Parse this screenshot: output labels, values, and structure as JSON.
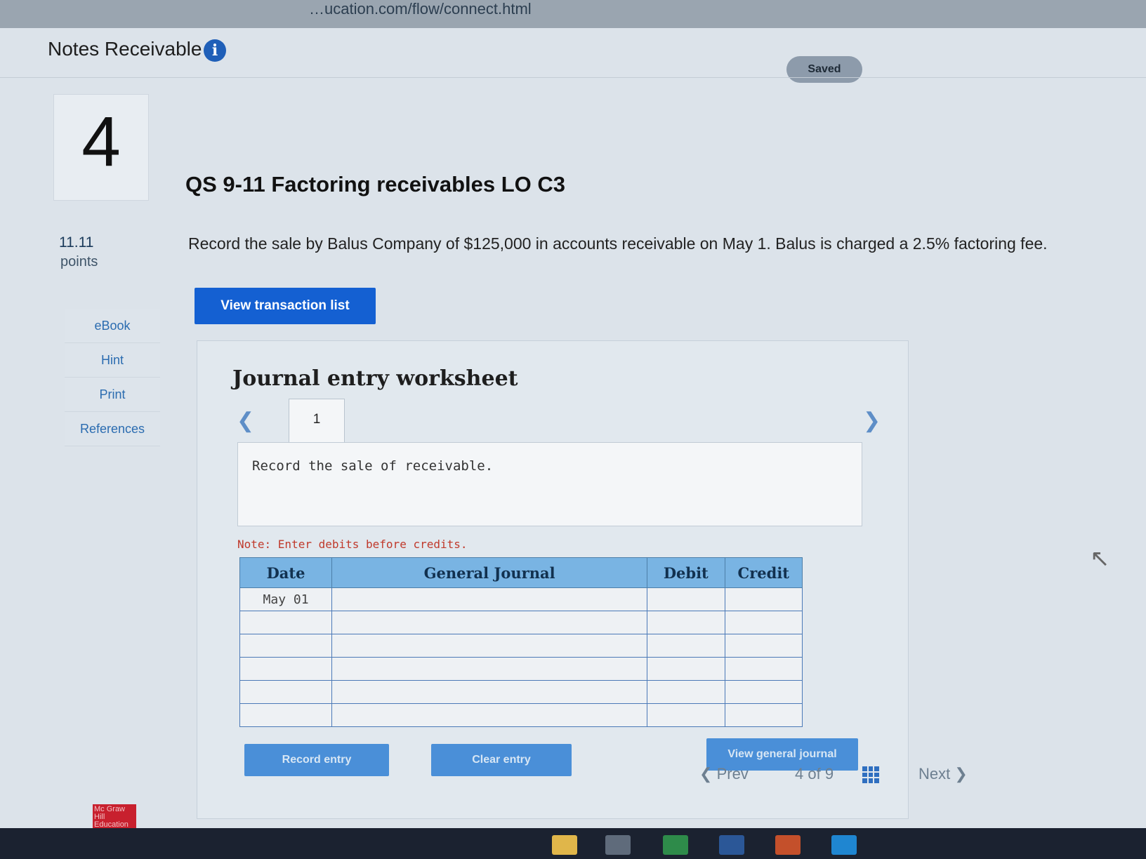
{
  "browser": {
    "url": "…ucation.com/flow/connect.html"
  },
  "header": {
    "title": "Notes Receivable",
    "saved_label": "Saved"
  },
  "question": {
    "number": "4",
    "title": "QS 9-11 Factoring receivables LO C3",
    "points_value": "11.11",
    "points_label": "points",
    "text": "Record the sale by Balus Company of $125,000 in accounts receivable on May 1. Balus is charged a 2.5% factoring fee."
  },
  "sidebar": {
    "items": [
      {
        "label": "eBook"
      },
      {
        "label": "Hint"
      },
      {
        "label": "Print"
      },
      {
        "label": "References"
      }
    ]
  },
  "buttons": {
    "view_transaction": "View transaction list",
    "record_entry": "Record entry",
    "clear_entry": "Clear entry",
    "view_general_journal": "View general journal"
  },
  "worksheet": {
    "title": "Journal entry worksheet",
    "tab_label": "1",
    "description": "Record the sale of receivable.",
    "note": "Note: Enter debits before credits.",
    "columns": {
      "date": "Date",
      "journal": "General Journal",
      "debit": "Debit",
      "credit": "Credit"
    },
    "rows": [
      {
        "date": "May 01",
        "account": "",
        "debit": "",
        "credit": ""
      },
      {
        "date": "",
        "account": "",
        "debit": "",
        "credit": ""
      },
      {
        "date": "",
        "account": "",
        "debit": "",
        "credit": ""
      },
      {
        "date": "",
        "account": "",
        "debit": "",
        "credit": ""
      },
      {
        "date": "",
        "account": "",
        "debit": "",
        "credit": ""
      },
      {
        "date": "",
        "account": "",
        "debit": "",
        "credit": ""
      }
    ]
  },
  "pager": {
    "prev": "Prev",
    "current": "4",
    "of": "of",
    "total": "9",
    "next": "Next"
  },
  "logo": {
    "text": "Mc Graw Hill Education"
  },
  "colors": {
    "accent": "#1460d2",
    "header_blue": "#79b4e3",
    "note_red": "#c0392b"
  }
}
